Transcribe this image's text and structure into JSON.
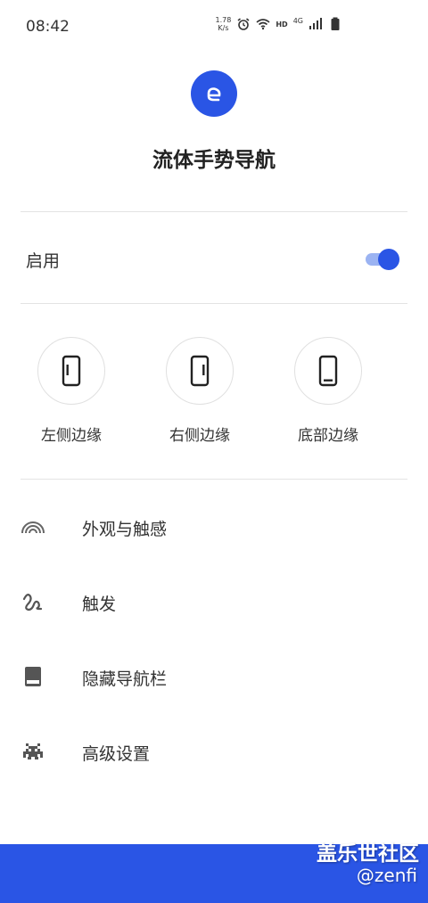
{
  "status_bar": {
    "time": "08:42",
    "speed_value": "1.78",
    "speed_unit": "K/s",
    "hd_label": "HD",
    "network_label": "4G",
    "icons": [
      "alarm-icon",
      "wifi-icon",
      "signal-icon",
      "battery-icon"
    ]
  },
  "app": {
    "title": "流体手势导航",
    "accent_color": "#2A55E5"
  },
  "enable": {
    "label": "启用",
    "toggle_on": true
  },
  "edges": [
    {
      "label": "左侧边缘",
      "icon": "phone-left-edge-icon"
    },
    {
      "label": "右侧边缘",
      "icon": "phone-right-edge-icon"
    },
    {
      "label": "底部边缘",
      "icon": "phone-bottom-edge-icon"
    }
  ],
  "menu": [
    {
      "label": "外观与触感",
      "icon": "rainbow-icon"
    },
    {
      "label": "触发",
      "icon": "squiggle-icon"
    },
    {
      "label": "隐藏导航栏",
      "icon": "navbar-hide-icon"
    },
    {
      "label": "高级设置",
      "icon": "space-invader-icon"
    }
  ],
  "watermark": {
    "line1": "盖乐世社区",
    "line2": "@zenfi"
  }
}
